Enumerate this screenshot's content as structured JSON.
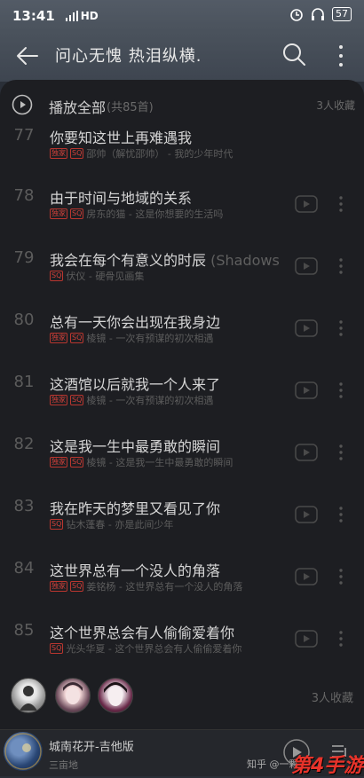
{
  "status_bar": {
    "time": "13:41",
    "network": "HD",
    "battery": "57"
  },
  "header": {
    "title": "问心无愧 热泪纵横."
  },
  "playall": {
    "label": "播放全部",
    "count": "(共85首)",
    "collect": "3人收藏"
  },
  "songs": [
    {
      "num": "77",
      "title": "你要知这世上再难遇我",
      "sub": "",
      "tags": [
        "独家",
        "SQ"
      ],
      "meta": "邵帅（解忧邵帅） - 我的少年时代"
    },
    {
      "num": "78",
      "title": "由于时间与地域的关系",
      "sub": "",
      "tags": [
        "独家",
        "SQ"
      ],
      "meta": "房东的猫 - 这是你想要的生活吗"
    },
    {
      "num": "79",
      "title": "我会在每个有意义的时辰",
      "sub": " (Shadows u···",
      "tags": [
        "SQ"
      ],
      "meta": "伏仪 - 硬骨见画集"
    },
    {
      "num": "80",
      "title": "总有一天你会出现在我身边",
      "sub": "",
      "tags": [
        "独家",
        "SQ"
      ],
      "meta": "棱镜 - 一次有预谋的初次相遇"
    },
    {
      "num": "81",
      "title": "这酒馆以后就我一个人来了",
      "sub": "",
      "tags": [
        "独家",
        "SQ"
      ],
      "meta": "棱镜 - 一次有预谋的初次相遇"
    },
    {
      "num": "82",
      "title": "这是我一生中最勇敢的瞬间",
      "sub": "",
      "tags": [
        "独家",
        "SQ"
      ],
      "meta": "棱镜 - 这是我一生中最勇敢的瞬间"
    },
    {
      "num": "83",
      "title": "我在昨天的梦里又看见了你",
      "sub": "",
      "tags": [
        "SQ"
      ],
      "meta": "钻木蓬春 - 亦是此间少年"
    },
    {
      "num": "84",
      "title": "这世界总有一个没人的角落",
      "sub": "",
      "tags": [
        "独家",
        "SQ"
      ],
      "meta": "姜铭杨 - 这世界总有一个没人的角落"
    },
    {
      "num": "85",
      "title": "这个世界总会有人偷偷爱着你",
      "sub": "",
      "tags": [
        "SQ"
      ],
      "meta": "光头华夏 - 这个世界总会有人偷偷爱着你"
    }
  ],
  "fans": {
    "collect": "3人收藏"
  },
  "player": {
    "title": "城南花开-吉他版",
    "artist": "三亩地"
  },
  "watermark": {
    "left": "知乎 @一颗",
    "right": "第4手游"
  },
  "colors": {
    "accent": "#d0413a",
    "sheet_bg": "#1d1e22",
    "header_bg": "#4a525c"
  },
  "icons": [
    "back-arrow-icon",
    "search-icon",
    "more-vertical-icon",
    "play-circle-icon",
    "mv-play-icon",
    "dots-icon",
    "playlist-icon"
  ]
}
